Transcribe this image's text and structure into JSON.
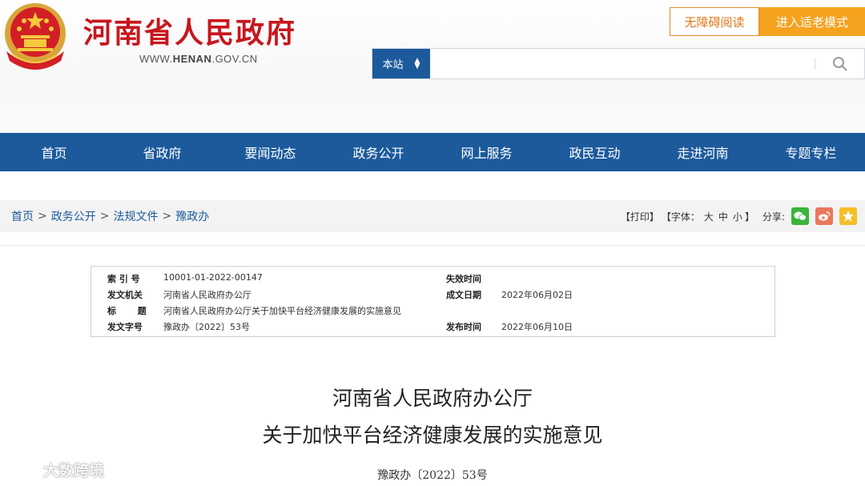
{
  "header": {
    "site_title": "河南省人民政府",
    "url_prefix": "WWW.",
    "url_bold": "HENAN",
    "url_suffix": ".GOV.CN",
    "accessibility_label": "无障碍阅读",
    "elder_mode_label": "进入适老模式"
  },
  "search": {
    "scope_label": "本站",
    "placeholder": ""
  },
  "nav": {
    "items": [
      "首页",
      "省政府",
      "要闻动态",
      "政务公开",
      "网上服务",
      "政民互动",
      "走进河南",
      "专题专栏"
    ]
  },
  "breadcrumb": {
    "items": [
      "首页",
      "政务公开",
      "法规文件",
      "豫政办"
    ],
    "separator": ">"
  },
  "tools": {
    "print_label": "【打印】",
    "font_label_open": "【字体：",
    "font_large": "大",
    "font_medium": "中",
    "font_small": "小",
    "font_label_close": "】",
    "share_label": "分享:"
  },
  "meta": {
    "index_label": "索  引  号",
    "index_value": "10001-01-2022-00147",
    "expire_label": "失效时间",
    "expire_value": "",
    "issuer_label": "发文机关",
    "issuer_value": "河南省人民政府办公厅",
    "written_label": "成文日期",
    "written_value": "2022年06月02日",
    "title_label": "标       题",
    "title_value": "河南省人民政府办公厅关于加快平台经济健康发展的实施意见",
    "docno_label": "发文字号",
    "docno_value": "豫政办〔2022〕53号",
    "publish_label": "发布时间",
    "publish_value": "2022年06月10日"
  },
  "document": {
    "title_line1": "河南省人民政府办公厅",
    "title_line2": "关于加快平台经济健康发展的实施意见",
    "number": "豫政办〔2022〕53号"
  },
  "watermark": {
    "text": "大数跨境"
  },
  "colors": {
    "brand_red": "#c8161d",
    "nav_blue": "#1c5a9c",
    "elder_orange": "#f5a21e"
  }
}
